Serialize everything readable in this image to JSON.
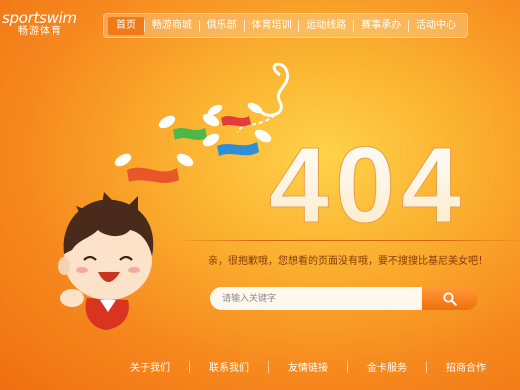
{
  "brand": {
    "name": "sportswim",
    "subtitle": "畅游体育"
  },
  "nav": {
    "items": [
      {
        "label": "首页",
        "active": true
      },
      {
        "label": "畅游商城",
        "active": false
      },
      {
        "label": "俱乐部",
        "active": false
      },
      {
        "label": "体育培训",
        "active": false
      },
      {
        "label": "运动线路",
        "active": false
      },
      {
        "label": "赛事承办",
        "active": false
      },
      {
        "label": "活动中心",
        "active": false
      }
    ]
  },
  "error": {
    "code": "404",
    "message": "亲，很抱歉哦，您想看的页面没有哦，要不搜搜比基尼美女吧！"
  },
  "search": {
    "placeholder": "请输入关键字",
    "button_icon": "search-icon"
  },
  "footer": {
    "links": [
      "关于我们",
      "联系我们",
      "友情链接",
      "金卡服务",
      "招商合作"
    ]
  },
  "colors": {
    "accent": "#f07a16",
    "background": "#f6891e",
    "text_dark": "#8a3a05"
  }
}
